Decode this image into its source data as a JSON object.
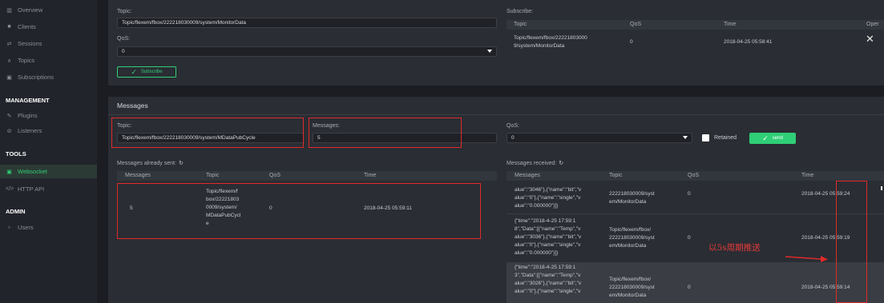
{
  "sidebar": {
    "items": [
      {
        "label": "Overview",
        "icon": "chart-icon"
      },
      {
        "label": "Clients",
        "icon": "clients-icon"
      },
      {
        "label": "Sessions",
        "icon": "sessions-icon"
      },
      {
        "label": "Topics",
        "icon": "topics-icon"
      },
      {
        "label": "Subscriptions",
        "icon": "subscriptions-icon"
      }
    ],
    "management": {
      "title": "MANAGEMENT",
      "items": [
        {
          "label": "Plugins"
        },
        {
          "label": "Listeners"
        }
      ]
    },
    "tools": {
      "title": "TOOLS",
      "items": [
        {
          "label": "Websocket",
          "active": true
        },
        {
          "label": "HTTP API"
        }
      ]
    },
    "admin": {
      "title": "ADMIN",
      "items": [
        {
          "label": "Users"
        }
      ]
    }
  },
  "subscribe_form": {
    "topic_label": "Topic:",
    "topic_value": "Topic/flexem/fbox/222218030009/system/MonitorData",
    "qos_label": "QoS:",
    "qos_value": "0",
    "button_label": "Subscribe"
  },
  "subscribe_table": {
    "title": "Subscribe:",
    "headers": [
      "Topic",
      "QoS",
      "Time",
      "Oper"
    ],
    "rows": [
      {
        "topic": "Topic/flexem/fbox/22221803000\n9/system/MonitorData",
        "qos": "0",
        "time": "2018-04-25 05:58:41"
      }
    ]
  },
  "messages": {
    "title": "Messages",
    "topic_label": "Topic:",
    "topic_value": "Topic/flexem/fbox/222218030009/system/MDataPubCycle",
    "messages_label": "Messages:",
    "messages_value": "5",
    "qos_label": "QoS:",
    "qos_value": "0",
    "retained_label": "Retained",
    "send_label": "send"
  },
  "sent": {
    "title": "Messages already sent:",
    "headers": [
      "Messages",
      "Topic",
      "QoS",
      "Time"
    ],
    "rows": [
      {
        "message": "5",
        "topic": "Topic/flexem/f\nbox/22221803\n0009/system/\nMDataPubCycl\ne",
        "qos": "0",
        "time": "2018-04-25 05:59:11"
      }
    ]
  },
  "received": {
    "title": "Messages received:",
    "headers": [
      "Messages",
      "Topic",
      "QoS",
      "Time"
    ],
    "rows": [
      {
        "message": "alue\":\"3046\"},{\"name\":\"bit\",\"v\nalue\":\"0\"},{\"name\":\"single\",\"v\nalue\":\"0.000000\"}]}",
        "topic": "222218030009/syst\nem/MonitorData",
        "qos": "0",
        "time": "2018-04-25 05:59:24"
      },
      {
        "message": "{\"time\":\"2018-4-25 17:59:1\n8\",\"Data\":[{\"name\":\"Temp\",\"v\nalue\":\"3036\"},{\"name\":\"bit\",\"v\nalue\":\"0\"},{\"name\":\"single\",\"v\nalue\":\"0.000000\"}]}",
        "topic": "Topic/flexem/fbox/\n222218030009/syst\nem/MonitorData",
        "qos": "0",
        "time": "2018-04-25 05:59:19"
      },
      {
        "message": "{\"time\":\"2018-4-25 17:59:1\n3\",\"Data\":[{\"name\":\"Temp\",\"v\nalue\":\"3026\"},{\"name\":\"bit\",\"v\nalue\":\"0\"},{\"name\":\"single\",\"v",
        "topic": "Topic/flexem/fbox/\n222218030009/syst\nem/MonitorData",
        "qos": "0",
        "time": "2018-04-25 05:59:14"
      }
    ]
  },
  "annotation": {
    "text": "以5s周期推送"
  },
  "colors": {
    "accent": "#2fcf77",
    "annotation": "#e02a2a",
    "background": "#1b1d22",
    "panel": "#2a2d33"
  }
}
